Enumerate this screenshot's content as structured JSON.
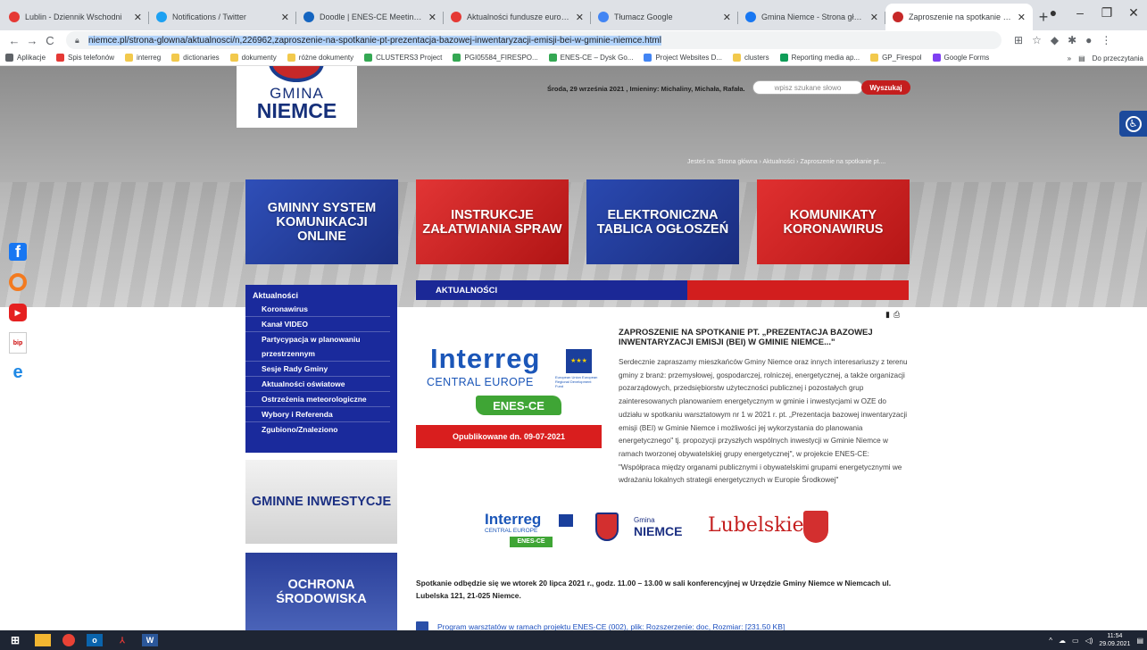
{
  "browser": {
    "tabs": [
      {
        "title": "Lublin - Dziennik Wschodni",
        "icon": "lublin-icon",
        "color": "#e53935",
        "active": false
      },
      {
        "title": "Notifications / Twitter",
        "icon": "twitter-icon",
        "color": "#1da1f2",
        "active": false
      },
      {
        "title": "Doodle | ENES-CE Meeting in Bu",
        "icon": "doodle-icon",
        "color": "#1565c0",
        "active": false
      },
      {
        "title": "Aktualności fundusze europejsk",
        "icon": "funds-icon",
        "color": "#e53935",
        "active": false
      },
      {
        "title": "Tłumacz Google",
        "icon": "translate-icon",
        "color": "#4285f4",
        "active": false
      },
      {
        "title": "Gmina Niemce - Strona główna",
        "icon": "facebook-icon",
        "color": "#1877f2",
        "active": false
      },
      {
        "title": "Zaproszenie na spotkanie pt. „Pr",
        "icon": "niemce-icon",
        "color": "#c62828",
        "active": true
      }
    ],
    "url": "niemce.pl/strona-glowna/aktualnosci/n,226962,zaproszenie-na-spotkanie-pt-prezentacja-bazowej-inwentaryzacji-emisji-bei-w-gminie-niemce.html",
    "bookmarks": [
      {
        "label": "Aplikacje",
        "color": "#5f6368"
      },
      {
        "label": "Spis telefonów",
        "color": "#e53935"
      },
      {
        "label": "interreg",
        "color": "#f2c94c"
      },
      {
        "label": "dictionaries",
        "color": "#f2c94c"
      },
      {
        "label": "dokumenty",
        "color": "#f2c94c"
      },
      {
        "label": "różne dokumenty",
        "color": "#f2c94c"
      },
      {
        "label": "CLUSTERS3 Project",
        "color": "#34a853"
      },
      {
        "label": "PGI05584_FIRESPO...",
        "color": "#34a853"
      },
      {
        "label": "ENES-CE – Dysk Go...",
        "color": "#34a853"
      },
      {
        "label": "Project Websites D...",
        "color": "#4285f4"
      },
      {
        "label": "clusters",
        "color": "#f2c94c"
      },
      {
        "label": "Reporting media ap...",
        "color": "#0f9d58"
      },
      {
        "label": "GP_Firespol",
        "color": "#f2c94c"
      },
      {
        "label": "Google Forms",
        "color": "#7e3ff2"
      }
    ],
    "reading_list": "Do przeczytania"
  },
  "site": {
    "logo_line1": "GMINA",
    "logo_line2": "NIEMCE",
    "date_text": "Środa, 29 września 2021 , Imieniny: Michaliny, Michała, Rafała.",
    "search_placeholder": "wpisz szukane słowo",
    "search_button": "Wyszukaj",
    "breadcrumb": "Jesteś na: Strona główna › Aktualności › Zaproszenie na spotkanie pt....",
    "tiles": [
      "GMINNY SYSTEM KOMUNIKACJI ONLINE",
      "INSTRUKCJE ZAŁATWIANIA SPRAW",
      "ELEKTRONICZNA TABLICA OGŁOSZEŃ",
      "KOMUNIKATY KORONAWIRUS"
    ],
    "menu": {
      "heading": "Aktualności",
      "items": [
        "Koronawirus",
        "Kanał VIDEO",
        "Partycypacja w planowaniu przestrzennym",
        "Sesje Rady Gminy",
        "Aktualności oświatowe",
        "Ostrzeżenia meteorologiczne",
        "Wybory i Referenda",
        "Zgubiono/Znaleziono"
      ]
    },
    "side_tiles": [
      "GMINNE INWESTYCJE",
      "OCHRONA ŚRODOWISKA"
    ]
  },
  "article": {
    "section": "AKTUALNOŚCI",
    "interreg": "Interreg",
    "central_europe": "CENTRAL EUROPE",
    "eu_fund": "European Union European Regional Development Fund",
    "enes": "ENES-CE",
    "published": "Opublikowane dn. 09-07-2021",
    "title": "ZAPROSZENIE NA SPOTKANIE PT. „PREZENTACJA BAZOWEJ INWENTARYZACJI EMISJI (BEI) W GMINIE NIEMCE...\"",
    "body": "Serdecznie zapraszamy mieszkańców Gminy Niemce oraz innych interesariuszy z terenu gminy z branż: przemysłowej, gospodarczej, rolniczej, energetycznej, a także organizacji pozarządowych, przedsiębiorstw użyteczności publicznej i pozostałych grup zainteresowanych planowaniem energetycznym w gminie i inwestycjami w OZE do udziału w spotkaniu warsztatowym nr 1 w 2021 r. pt. „Prezentacja bazowej inwentaryzacji emisji (BEI) w Gminie Niemce i możliwości jej wykorzystania do planowania energetycznego\" tj. propozycji przyszłych wspólnych inwestycji w Gminie Niemce w ramach tworzonej obywatelskiej grupy energetycznej\", w projekcie ENES-CE: \"Współpraca między organami publicznymi i obywatelskimi grupami energetycznymi we wdrażaniu lokalnych strategii energetycznych w Europie Środkowej\"",
    "partner_interreg": "Interreg",
    "partner_ce": "CENTRAL EUROPE",
    "partner_enes": "ENES-CE",
    "partner_gmina_small": "Gmina",
    "partner_gmina": "NIEMCE",
    "partner_lubelskie": "Lubelskie",
    "meeting": "Spotkanie odbędzie się we wtorek 20 lipca  2021 r., godz. 11.00 – 13.00 w  sali konferencyjnej w Urzędzie Gminy Niemce w Niemcach ul. Lubelska 121, 21-025 Niemce.",
    "download": "Program warsztatów w ramach projektu ENES-CE (002), plik: Rozszerzenie: doc, Rozmiar: [231.50 KB]"
  },
  "taskbar": {
    "time": "11:54",
    "date": "29.09.2021"
  }
}
